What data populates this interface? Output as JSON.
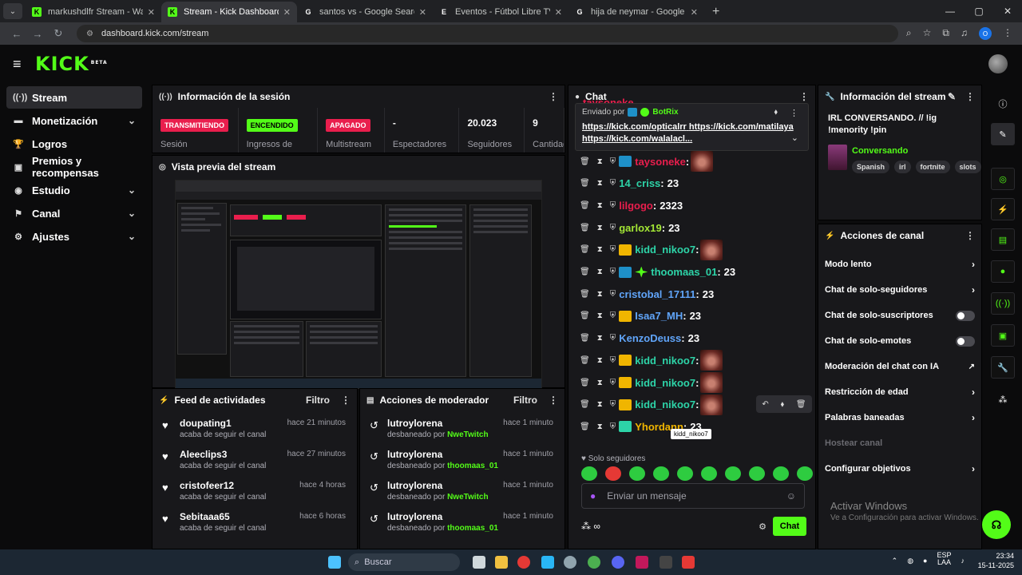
{
  "browser": {
    "tabs": [
      {
        "title": "markushdlfr Stream - Watch Live",
        "fav_color": "#53fc18",
        "fav_text": "K"
      },
      {
        "title": "Stream - Kick Dashboard",
        "fav_color": "#53fc18",
        "fav_text": "K"
      },
      {
        "title": "santos vs - Google Search",
        "fav_color": "#ffffff",
        "fav_text": "G"
      },
      {
        "title": "Eventos - Fútbol Libre TV",
        "fav_color": "#ffffff",
        "fav_text": "E"
      },
      {
        "title": "hija de neymar - Google Search",
        "fav_color": "#ffffff",
        "fav_text": "G"
      }
    ],
    "url": "dashboard.kick.com/stream"
  },
  "nav": {
    "logo": "KICK",
    "beta": "BETA"
  },
  "sidebar": {
    "items": [
      {
        "label": "Stream",
        "icon": "broadcast-icon",
        "glyph": "((·))",
        "expand": false
      },
      {
        "label": "Monetización",
        "icon": "money-icon",
        "glyph": "▬",
        "expand": true
      },
      {
        "label": "Logros",
        "icon": "trophy-icon",
        "glyph": "🏆",
        "expand": false
      },
      {
        "label": "Premios y recompensas",
        "icon": "gift-icon",
        "glyph": "▣",
        "expand": false
      },
      {
        "label": "Estudio",
        "icon": "studio-icon",
        "glyph": "◉",
        "expand": true
      },
      {
        "label": "Canal",
        "icon": "channel-icon",
        "glyph": "⚑",
        "expand": true
      },
      {
        "label": "Ajustes",
        "icon": "gear-icon",
        "glyph": "⚙",
        "expand": true
      }
    ]
  },
  "session": {
    "title": "Información de la sesión",
    "stats": [
      {
        "badge": "TRANSMITIENDO",
        "badge_color": "red",
        "sub": "Sesión"
      },
      {
        "badge": "ENCENDIDO",
        "badge_color": "green",
        "sub": "Ingresos de"
      },
      {
        "badge": "APAGADO",
        "badge_color": "red",
        "sub": "Multistream"
      },
      {
        "value": "-",
        "sub": "Espectadores"
      },
      {
        "value": "20.023",
        "sub": "Seguidores"
      },
      {
        "value": "9",
        "sub": "Cantidad de"
      }
    ]
  },
  "preview": {
    "title": "Vista previa del stream"
  },
  "feed": {
    "title": "Feed de actividades",
    "filter": "Filtro",
    "items": [
      {
        "name": "doupating1",
        "time": "hace 21 minutos",
        "desc": "acaba de seguir el canal"
      },
      {
        "name": "Aleeclips3",
        "time": "hace 27 minutos",
        "desc": "acaba de seguir el canal"
      },
      {
        "name": "cristofeer12",
        "time": "hace 4 horas",
        "desc": "acaba de seguir el canal"
      },
      {
        "name": "Sebitaaa65",
        "time": "hace 6 horas",
        "desc": "acaba de seguir el canal"
      }
    ]
  },
  "modactions": {
    "title": "Acciones de moderador",
    "filter": "Filtro",
    "items": [
      {
        "name": "lutroylorena",
        "time": "hace 1 minuto",
        "desc": "desbaneado por",
        "by": "NweTwitch"
      },
      {
        "name": "lutroylorena",
        "time": "hace 1 minuto",
        "desc": "desbaneado por",
        "by": "thoomaas_01"
      },
      {
        "name": "lutroylorena",
        "time": "hace 1 minuto",
        "desc": "desbaneado por",
        "by": "NweTwitch"
      },
      {
        "name": "lutroylorena",
        "time": "hace 1 minuto",
        "desc": "desbaneado por",
        "by": "thoomaas_01"
      }
    ]
  },
  "chat": {
    "title": "Chat",
    "top_partial": "taysoneke",
    "pinned": {
      "prefix": "Enviado por",
      "bot": "BotRix",
      "link1": "https://kick.com/opticalrr",
      "link2": "https://kick.com/matilaya",
      "link3": "https://kick.com/walalacl..."
    },
    "messages": [
      {
        "user": "taysoneke",
        "color": "#e91e4d",
        "badges": [
          "b-blue"
        ],
        "text": "",
        "emote": true
      },
      {
        "user": "14_criss",
        "color": "#2dd4a8",
        "badges": [],
        "text": "23",
        "emote": false
      },
      {
        "user": "lilgogo",
        "color": "#e91e4d",
        "badges": [],
        "text": "2323",
        "emote": false
      },
      {
        "user": "garlox19",
        "color": "#a3e635",
        "badges": [],
        "text": "23",
        "emote": false
      },
      {
        "user": "kidd_nikoo7",
        "color": "#2dd4a8",
        "badges": [
          "b-crown"
        ],
        "text": "",
        "emote": true
      },
      {
        "user": "thoomaas_01",
        "color": "#2dd4a8",
        "badges": [
          "b-blue",
          "b-spark"
        ],
        "text": "23",
        "emote": false
      },
      {
        "user": "cristobal_17111",
        "color": "#60a5fa",
        "badges": [],
        "text": "23",
        "emote": false
      },
      {
        "user": "Isaa7_MH",
        "color": "#60a5fa",
        "badges": [
          "b-crown"
        ],
        "text": "23",
        "emote": false
      },
      {
        "user": "KenzoDeuss",
        "color": "#60a5fa",
        "badges": [],
        "text": "23",
        "emote": false
      },
      {
        "user": "kidd_nikoo7",
        "color": "#2dd4a8",
        "badges": [
          "b-crown"
        ],
        "text": "",
        "emote": true
      },
      {
        "user": "kidd_nikoo7",
        "color": "#2dd4a8",
        "badges": [
          "b-crown"
        ],
        "text": "",
        "emote": true
      },
      {
        "user": "kidd_nikoo7",
        "color": "#2dd4a8",
        "badges": [
          "b-crown"
        ],
        "text": "",
        "emote": true
      },
      {
        "user": "Yhordann",
        "color": "#f0b500",
        "badges": [
          "b-cake"
        ],
        "text": "23",
        "emote": false
      }
    ],
    "tooltip": "kidd_nikoo7",
    "followers_only": "Solo seguidores",
    "input_placeholder": "Enviar un mensaje",
    "send": "Chat"
  },
  "streaminfo": {
    "title": "Información del stream",
    "stream_title": "IRL CONVERSANDO. // !ig !menority !pin",
    "category": "Conversando",
    "tags": [
      "Spanish",
      "irl",
      "fortnite",
      "slots"
    ]
  },
  "channelactions": {
    "title": "Acciones de canal",
    "items": [
      {
        "label": "Modo lento",
        "kind": "chev"
      },
      {
        "label": "Chat de solo-seguidores",
        "kind": "chev"
      },
      {
        "label": "Chat de solo-suscriptores",
        "kind": "toggle"
      },
      {
        "label": "Chat de solo-emotes",
        "kind": "toggle"
      },
      {
        "label": "Moderación del chat con IA",
        "kind": "ext"
      },
      {
        "label": "Restricción de edad",
        "kind": "chev"
      },
      {
        "label": "Palabras baneadas",
        "kind": "chev"
      },
      {
        "label": "Hostear canal",
        "kind": "disabled"
      },
      {
        "label": "Configurar objetivos",
        "kind": "chev"
      }
    ]
  },
  "windows": {
    "activate": "Activar Windows",
    "activate_sub": "Ve a Configuración para activar Windows."
  },
  "taskbar": {
    "search": "Buscar",
    "lang": "ESP",
    "lang2": "LAA",
    "time": "23:34",
    "date": "15-11-2025"
  }
}
